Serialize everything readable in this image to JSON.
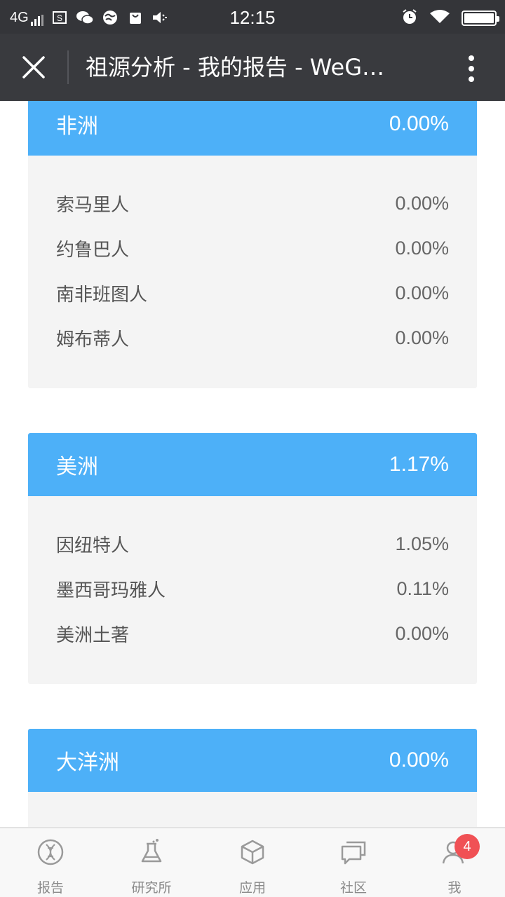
{
  "status_bar": {
    "network": "4G",
    "time": "12:15",
    "icons": [
      "signal-icon",
      "screenshot-icon",
      "wechat-icon",
      "globe-icon",
      "bag-icon",
      "volume-icon",
      "alarm-icon",
      "wifi-icon",
      "battery-icon"
    ]
  },
  "title_bar": {
    "title": "祖源分析 - 我的报告 - WeG…",
    "close_icon": "close-icon",
    "more_icon": "more-vertical-icon"
  },
  "sections": [
    {
      "name": "非洲",
      "percent": "0.00%",
      "items": [
        {
          "name": "索马里人",
          "percent": "0.00%"
        },
        {
          "name": "约鲁巴人",
          "percent": "0.00%"
        },
        {
          "name": "南非班图人",
          "percent": "0.00%"
        },
        {
          "name": "姆布蒂人",
          "percent": "0.00%"
        }
      ]
    },
    {
      "name": "美洲",
      "percent": "1.17%",
      "items": [
        {
          "name": "因纽特人",
          "percent": "1.05%"
        },
        {
          "name": "墨西哥玛雅人",
          "percent": "0.11%"
        },
        {
          "name": "美洲土著",
          "percent": "0.00%"
        }
      ]
    },
    {
      "name": "大洋洲",
      "percent": "0.00%",
      "items": []
    }
  ],
  "bottom_nav": [
    {
      "label": "报告",
      "icon": "dna-icon"
    },
    {
      "label": "研究所",
      "icon": "flask-icon"
    },
    {
      "label": "应用",
      "icon": "cube-icon"
    },
    {
      "label": "社区",
      "icon": "chat-icon"
    },
    {
      "label": "我",
      "icon": "person-icon",
      "badge": "4"
    }
  ],
  "colors": {
    "header_blue": "#4db0f8",
    "badge_red": "#f05155",
    "titlebar": "#393a3e"
  }
}
